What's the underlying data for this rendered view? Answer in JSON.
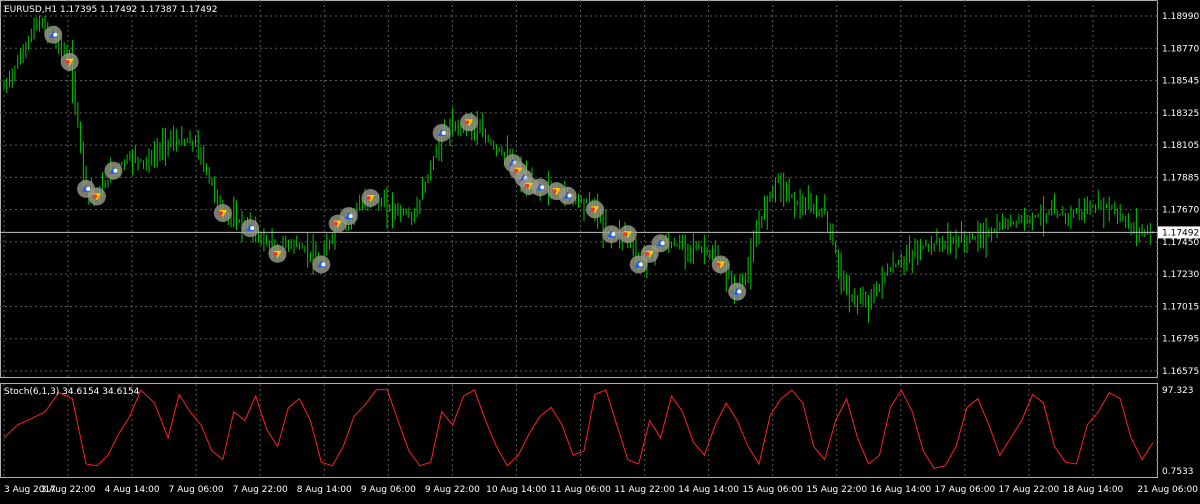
{
  "main": {
    "header": "EURUSD,H1  1.17395 1.17492 1.17387 1.17492",
    "price_ticks": [
      "1.18990",
      "1.18770",
      "1.18545",
      "1.18325",
      "1.18105",
      "1.17885",
      "1.17670",
      "1.17450",
      "1.17230",
      "1.17015",
      "1.16795",
      "1.16575"
    ],
    "current_price": "1.17492"
  },
  "oscillator": {
    "header": "Stoch(6,1,3) 34.6154 34.6154",
    "max_label": "97.323",
    "min_label": "0.7533"
  },
  "time_axis": {
    "labels": [
      "3 Aug 2017",
      "3 Aug 22:00",
      "4 Aug 14:00",
      "7 Aug 06:00",
      "7 Aug 22:00",
      "8 Aug 14:00",
      "9 Aug 06:00",
      "9 Aug 22:00",
      "10 Aug 14:00",
      "11 Aug 06:00",
      "11 Aug 22:00",
      "14 Aug 14:00",
      "15 Aug 06:00",
      "15 Aug 22:00",
      "16 Aug 14:00",
      "17 Aug 06:00",
      "17 Aug 22:00",
      "18 Aug 14:00",
      "21 Aug 06:00"
    ]
  },
  "colors": {
    "background": "#000000",
    "candles": "#00c800",
    "stochastic": "#ff2020",
    "buy_marker": "#1e5aff",
    "sell_marker": "#c8c8c8",
    "price_line": "#ffffff"
  },
  "chart_data": [
    {
      "type": "line",
      "title": "EURUSD,H1",
      "ylim": [
        1.16575,
        1.1899
      ],
      "x_range_hours": [
        0,
        420
      ],
      "x_tick_labels": [
        "3 Aug 2017",
        "3 Aug 22:00",
        "4 Aug 14:00",
        "7 Aug 06:00",
        "7 Aug 22:00",
        "8 Aug 14:00",
        "9 Aug 06:00",
        "9 Aug 22:00",
        "10 Aug 14:00",
        "11 Aug 06:00",
        "11 Aug 22:00",
        "14 Aug 14:00",
        "15 Aug 06:00",
        "15 Aug 22:00",
        "16 Aug 14:00",
        "17 Aug 06:00",
        "17 Aug 22:00",
        "18 Aug 14:00",
        "21 Aug 06:00"
      ],
      "series": [
        {
          "name": "EURUSD",
          "x": [
            0,
            5,
            12,
            18,
            24,
            30,
            34,
            40,
            46,
            52,
            60,
            70,
            80,
            90,
            100,
            104,
            110,
            116,
            118,
            122,
            126,
            134,
            140,
            150,
            160,
            170,
            180,
            186,
            192,
            200,
            208,
            215,
            220,
            222,
            228,
            232,
            240,
            250,
            256,
            262,
            268,
            272,
            276,
            282,
            290,
            300,
            308,
            314,
            318,
            322,
            326,
            332,
            336,
            342,
            352,
            360,
            366,
            376,
            382,
            388,
            396,
            404,
            412,
            420
          ],
          "values": [
            1.1845,
            1.1862,
            1.1888,
            1.188,
            1.1862,
            1.1778,
            1.1773,
            1.179,
            1.18,
            1.1795,
            1.181,
            1.1808,
            1.1762,
            1.1752,
            1.1735,
            1.1743,
            1.1738,
            1.1728,
            1.174,
            1.1755,
            1.176,
            1.1772,
            1.1766,
            1.176,
            1.1815,
            1.1822,
            1.1805,
            1.1795,
            1.178,
            1.1778,
            1.1772,
            1.1768,
            1.175,
            1.1748,
            1.1748,
            1.1728,
            1.1742,
            1.174,
            1.1738,
            1.1728,
            1.171,
            1.1725,
            1.1755,
            1.1785,
            1.1768,
            1.1762,
            1.1708,
            1.1702,
            1.1708,
            1.1722,
            1.1728,
            1.1735,
            1.174,
            1.1742,
            1.1745,
            1.1748,
            1.1755,
            1.176,
            1.1762,
            1.176,
            1.1765,
            1.1767,
            1.1752,
            1.1749
          ]
        }
      ],
      "current_price": 1.17492
    },
    {
      "type": "line",
      "title": "Stoch(6,1,3)",
      "ylim": [
        0.7533,
        97.323
      ],
      "x_range_hours": [
        0,
        420
      ],
      "series": [
        {
          "name": "Stoch(6,1,3)",
          "x": [
            0,
            5,
            10,
            15,
            20,
            25,
            30,
            34,
            38,
            42,
            46,
            50,
            55,
            60,
            64,
            68,
            72,
            76,
            80,
            84,
            88,
            92,
            96,
            100,
            104,
            108,
            112,
            116,
            120,
            124,
            128,
            132,
            136,
            140,
            144,
            148,
            152,
            156,
            160,
            164,
            168,
            172,
            176,
            180,
            184,
            188,
            192,
            196,
            200,
            204,
            208,
            212,
            216,
            220,
            224,
            228,
            232,
            236,
            240,
            244,
            248,
            252,
            256,
            260,
            264,
            268,
            272,
            276,
            280,
            284,
            288,
            292,
            296,
            300,
            304,
            308,
            312,
            316,
            320,
            324,
            328,
            332,
            336,
            340,
            344,
            348,
            352,
            356,
            360,
            364,
            368,
            372,
            376,
            380,
            384,
            388,
            392,
            396,
            400,
            404,
            408,
            412,
            416,
            420
          ],
          "values": [
            40,
            55,
            62,
            70,
            92,
            85,
            10,
            8,
            20,
            45,
            65,
            95,
            80,
            40,
            90,
            70,
            55,
            25,
            15,
            70,
            60,
            88,
            50,
            30,
            75,
            85,
            60,
            12,
            8,
            30,
            65,
            78,
            95,
            96,
            60,
            25,
            8,
            12,
            70,
            55,
            88,
            95,
            60,
            30,
            8,
            20,
            45,
            65,
            75,
            55,
            20,
            25,
            90,
            95,
            55,
            15,
            10,
            60,
            40,
            88,
            70,
            35,
            20,
            55,
            80,
            60,
            30,
            10,
            65,
            85,
            95,
            80,
            30,
            15,
            60,
            85,
            40,
            10,
            20,
            75,
            95,
            70,
            25,
            5,
            8,
            30,
            75,
            85,
            55,
            20,
            40,
            60,
            90,
            80,
            30,
            12,
            10,
            55,
            70,
            92,
            85,
            40,
            15,
            34.6
          ]
        }
      ]
    }
  ]
}
